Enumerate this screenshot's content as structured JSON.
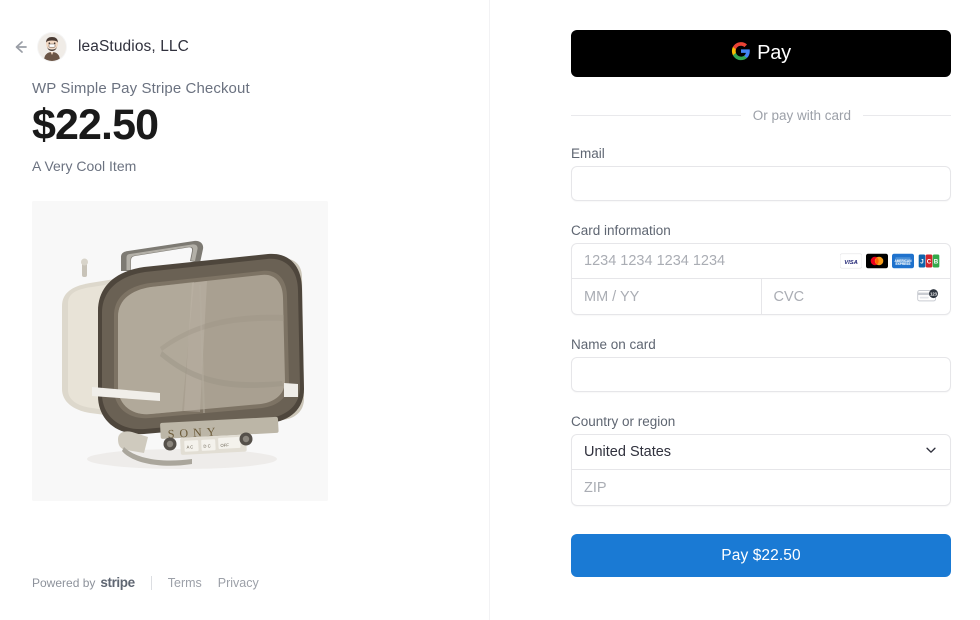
{
  "left": {
    "back_icon": "back-arrow-icon",
    "avatar_icon": "merchant-avatar",
    "merchant_name": "leaStudios, LLC",
    "product_title": "WP Simple Pay Stripe Checkout",
    "price": "$22.50",
    "description": "A Very Cool Item",
    "product_image_alt": "Vintage Sony portable television",
    "footer": {
      "powered_by": "Powered by",
      "stripe": "stripe",
      "terms": "Terms",
      "privacy": "Privacy"
    }
  },
  "right": {
    "gpay": {
      "label": "Pay",
      "icon": "google-g-icon"
    },
    "divider_text": "Or pay with card",
    "email": {
      "label": "Email",
      "value": "",
      "placeholder": ""
    },
    "card": {
      "label": "Card information",
      "number_placeholder": "1234 1234 1234 1234",
      "number_value": "",
      "expiry_placeholder": "MM / YY",
      "expiry_value": "",
      "cvc_placeholder": "CVC",
      "cvc_value": "",
      "brands": [
        "visa",
        "mastercard",
        "amex",
        "jcb"
      ],
      "cvc_icon": "cvc-card-icon"
    },
    "name_on_card": {
      "label": "Name on card",
      "value": "",
      "placeholder": ""
    },
    "country": {
      "label": "Country or region",
      "selected": "United States",
      "chevron_icon": "chevron-down-icon",
      "zip_placeholder": "ZIP",
      "zip_value": ""
    },
    "pay_button": "Pay $22.50"
  },
  "colors": {
    "accent_blue": "#1a7ad4",
    "gpay_black": "#000000",
    "text_dark": "#30313d",
    "text_muted": "#6b7280",
    "border": "#e6e6e9"
  }
}
